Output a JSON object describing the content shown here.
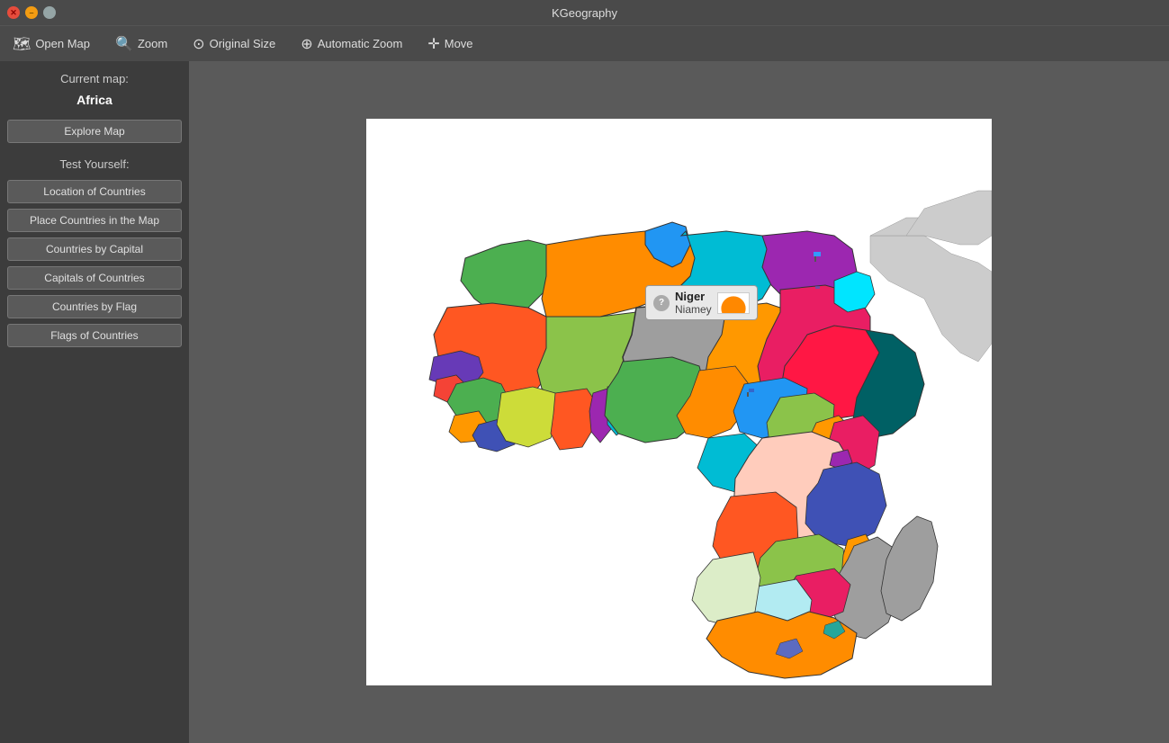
{
  "titleBar": {
    "title": "KGeography",
    "closeBtn": "✕",
    "minBtn": "–",
    "maxBtn": "□"
  },
  "toolbar": {
    "openMap": "Open Map",
    "zoom": "Zoom",
    "originalSize": "Original Size",
    "automaticZoom": "Automatic Zoom",
    "move": "Move"
  },
  "sidebar": {
    "currentMapLabel": "Current map:",
    "currentMapName": "Africa",
    "exploreMap": "Explore Map",
    "testYourself": "Test Yourself:",
    "locationOfCountries": "Location of Countries",
    "placeCountriesInTheMap": "Place Countries in the Map",
    "countriesByCapital": "Countries by Capital",
    "capitalsOfCountries": "Capitals of Countries",
    "countriesByFlag": "Countries by Flag",
    "flagsOfCountries": "Flags of Countries"
  },
  "tooltip": {
    "country": "Niger",
    "capital": "Niamey",
    "questionIcon": "?"
  }
}
